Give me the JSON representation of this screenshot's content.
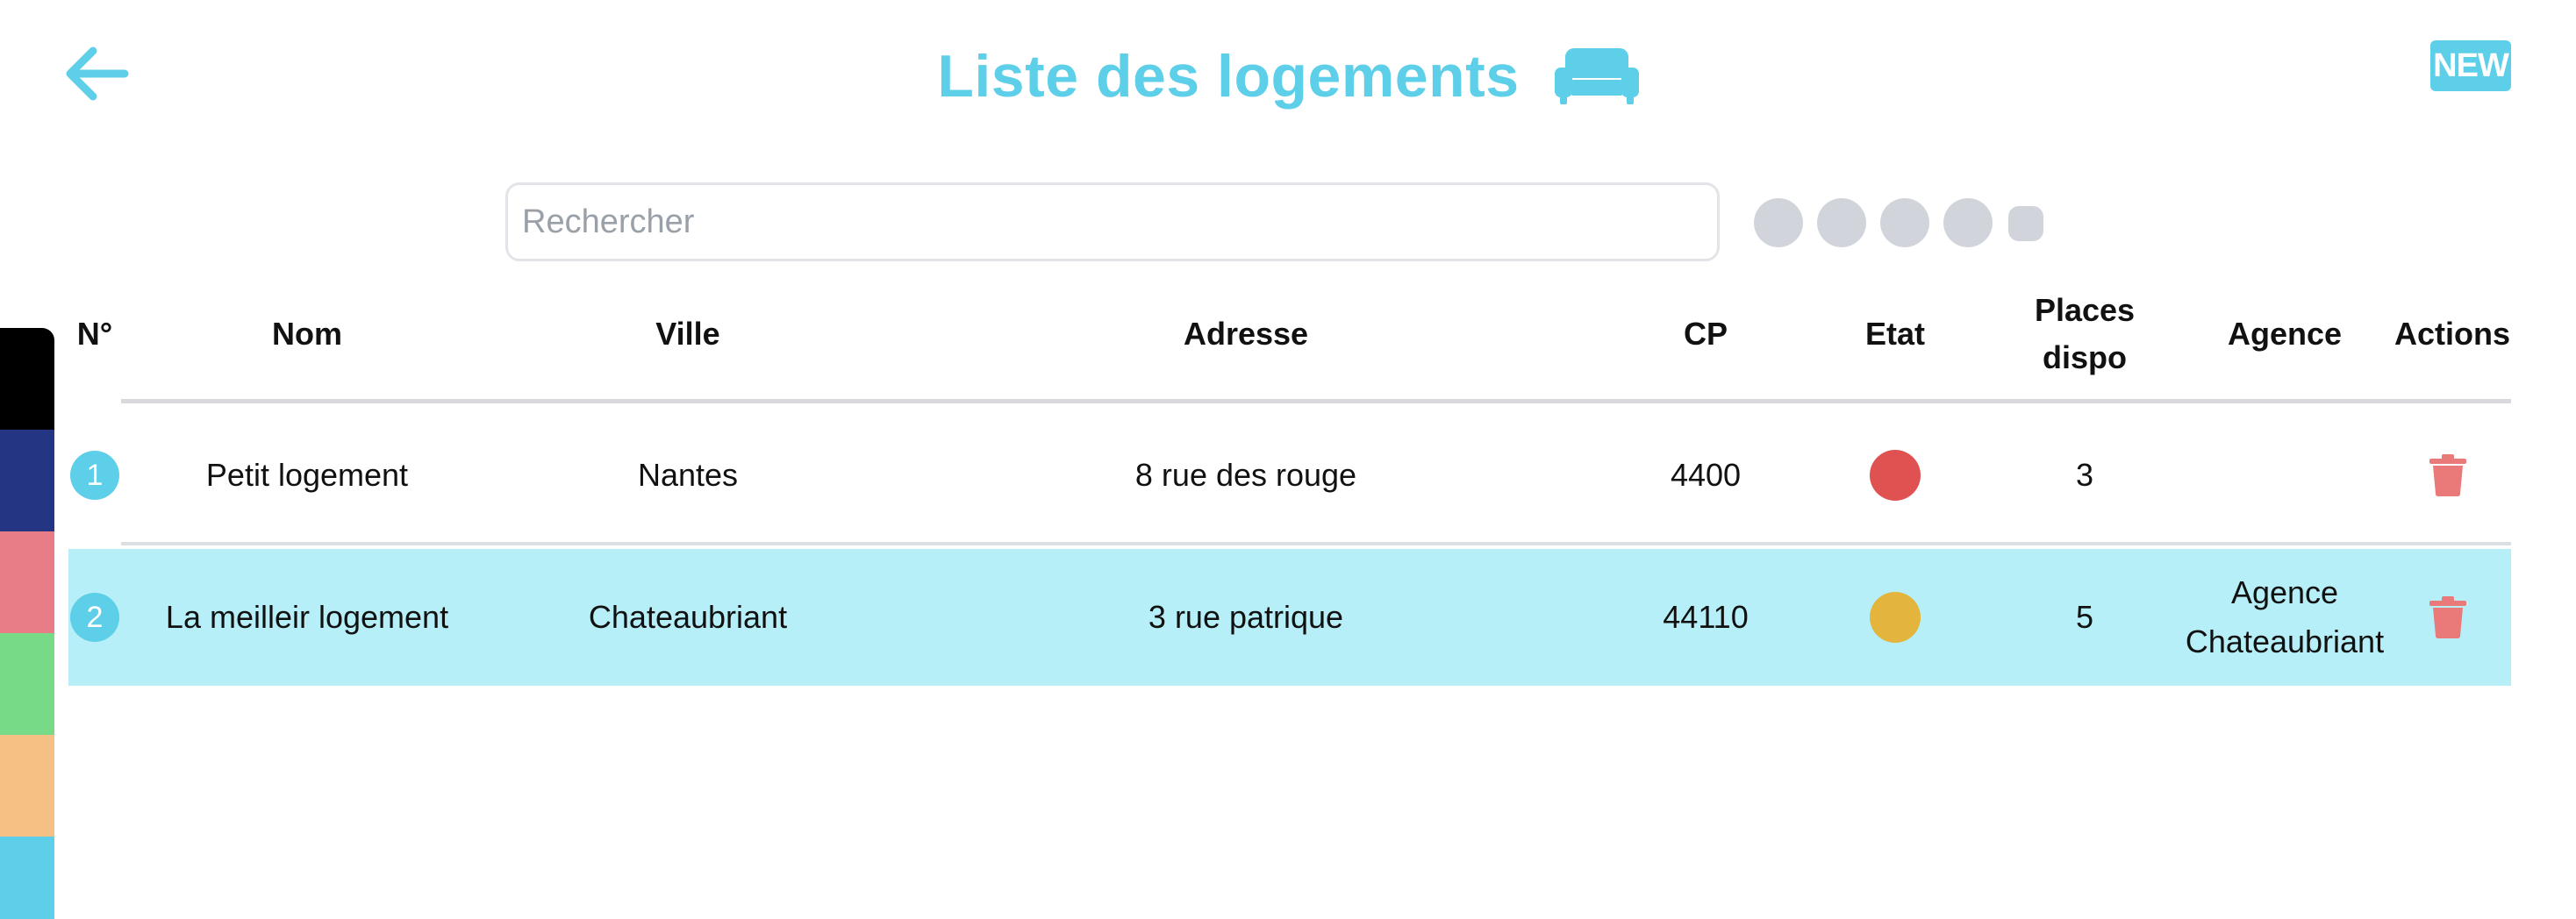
{
  "header": {
    "title": "Liste des logements",
    "new_label": "NEW",
    "back_icon": "arrow-left-icon",
    "title_icon": "sofa-icon"
  },
  "search": {
    "placeholder": "Rechercher",
    "value": ""
  },
  "table": {
    "headers": {
      "num": "N°",
      "nom": "Nom",
      "ville": "Ville",
      "adresse": "Adresse",
      "cp": "CP",
      "etat": "Etat",
      "places_line1": "Places",
      "places_line2": "dispo",
      "agence": "Agence",
      "actions": "Actions"
    },
    "rows": [
      {
        "num": "1",
        "nom": "Petit logement",
        "ville": "Nantes",
        "adresse": "8 rue des rouge",
        "cp": "4400",
        "etat_color": "#e05252",
        "places": "3",
        "agence_line1": "",
        "agence_line2": "",
        "selected": false
      },
      {
        "num": "2",
        "nom": "La meilleir logement",
        "ville": "Chateaubriant",
        "adresse": "3 rue patrique",
        "cp": "44110",
        "etat_color": "#e3b53d",
        "places": "5",
        "agence_line1": "Agence",
        "agence_line2": "Chateaubriant",
        "selected": true
      }
    ]
  },
  "colors": {
    "accent": "#5ecfe8",
    "selected_row": "#b6eff7",
    "delete": "#ea7a7a",
    "side_palette": [
      "#000000",
      "#243583",
      "#e97d87",
      "#76da86",
      "#f4c083",
      "#5ecfe8"
    ]
  }
}
